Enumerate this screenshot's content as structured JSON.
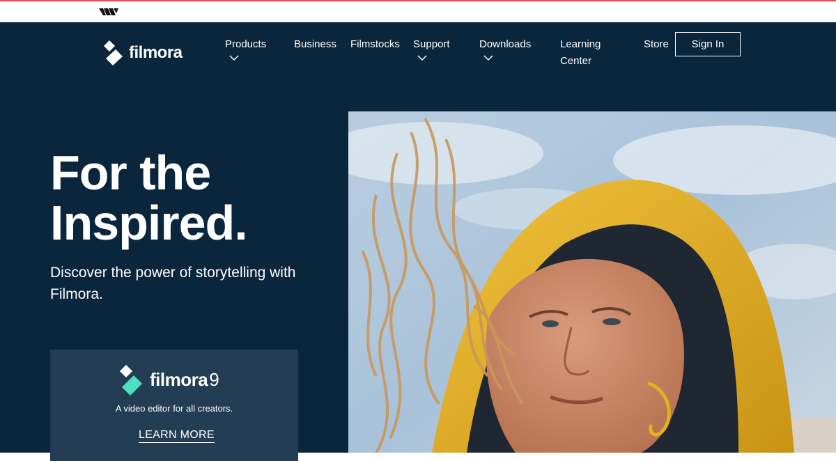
{
  "topbar": {
    "logo_icon": "wondershare-logo-icon"
  },
  "header": {
    "brand": {
      "text": "filmora",
      "icon": "filmora-logo-icon"
    },
    "nav": [
      {
        "label": "Products",
        "has_dropdown": true
      },
      {
        "label": "Business",
        "has_dropdown": false
      },
      {
        "label": "Filmstocks",
        "has_dropdown": false
      },
      {
        "label": "Support",
        "has_dropdown": true
      },
      {
        "label": "Downloads",
        "has_dropdown": true
      },
      {
        "label_line1": "Learning",
        "label_line2": "Center",
        "has_dropdown": false
      },
      {
        "label": "Store",
        "has_dropdown": false
      }
    ],
    "signin_label": "Sign In"
  },
  "hero": {
    "title_line1": "For the",
    "title_line2": "Inspired.",
    "subtitle": "Discover the power of storytelling with Filmora."
  },
  "product_card": {
    "name": "filmora",
    "version": "9",
    "tagline": "A video editor for all creators.",
    "link_label": "LEARN MORE"
  },
  "hero_image": {
    "subject": "hero-photo"
  },
  "colors": {
    "navy": "#0a263d",
    "card": "#233e54",
    "accent_teal": "#4be0c0",
    "top_accent": "#e64c55",
    "jacket_yellow": "#e7b52d"
  }
}
